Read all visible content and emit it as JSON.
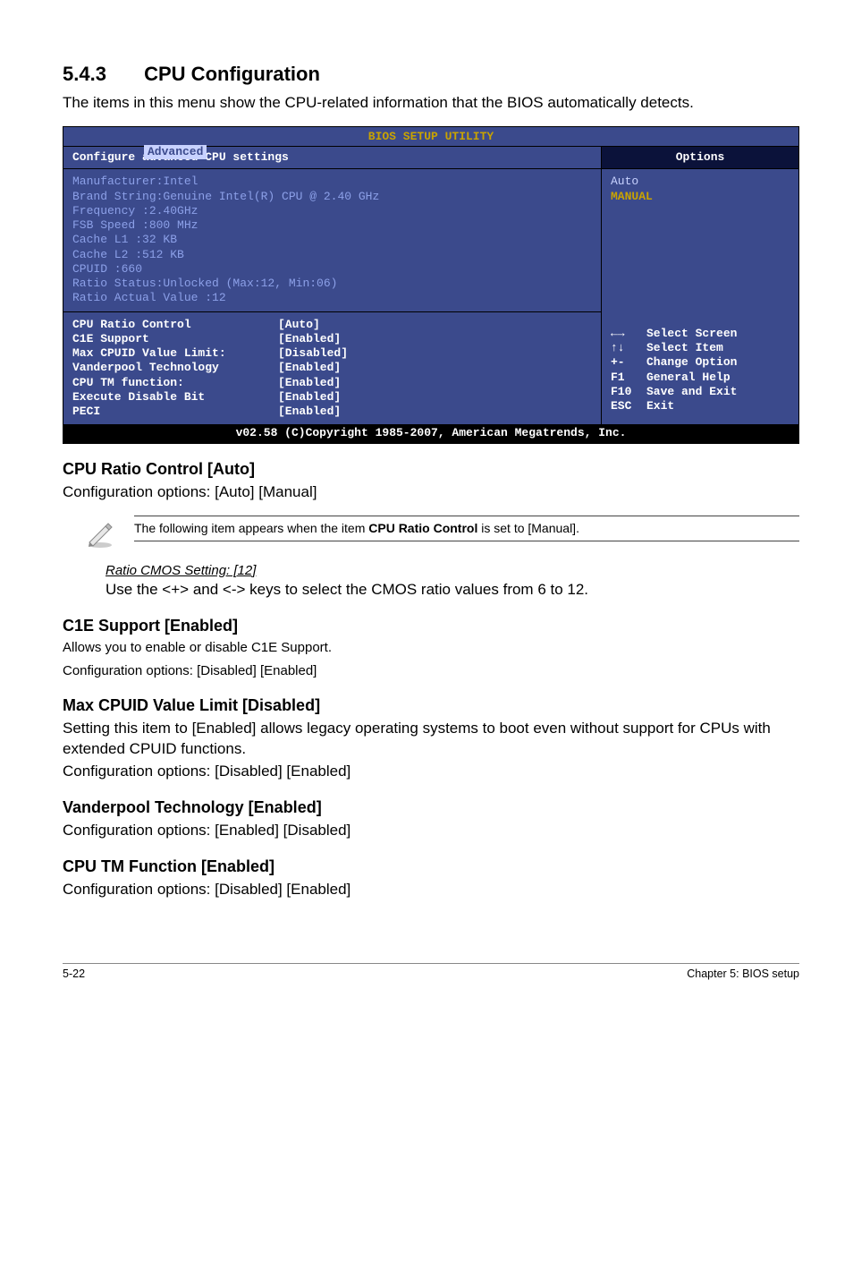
{
  "section": {
    "number": "5.4.3",
    "title": "CPU Configuration"
  },
  "intro": "The items in this menu show the CPU-related information that the BIOS automatically detects.",
  "bios": {
    "topTitle": "BIOS SETUP UTILITY",
    "tab": "Advanced",
    "leftHeader": "Configure advanced CPU settings",
    "info": {
      "l1": "Manufacturer:Intel",
      "l2": "Brand String:Genuine Intel(R) CPU @ 2.40 GHz",
      "l3": "Frequency   :2.40GHz",
      "l4": "FSB Speed   :800 MHz",
      "l5": "Cache L1    :32 KB",
      "l6": "Cache L2    :512 KB",
      "l7": "CPUID       :660",
      "l8": "Ratio Status:Unlocked (Max:12, Min:06)",
      "l9": "Ratio Actual Value  :12"
    },
    "settings": [
      {
        "k": "CPU Ratio Control",
        "v": "[Auto]"
      },
      {
        "k": "C1E Support",
        "v": "[Enabled]"
      },
      {
        "k": "Max CPUID Value Limit:",
        "v": "[Disabled]"
      },
      {
        "k": "Vanderpool Technology",
        "v": "[Enabled]"
      },
      {
        "k": "CPU TM function:",
        "v": "[Enabled]"
      },
      {
        "k": "Execute Disable Bit",
        "v": "[Enabled]"
      },
      {
        "k": "PECI",
        "v": "[Enabled]"
      }
    ],
    "rightHeader": "Options",
    "rightTop": {
      "auto": "Auto",
      "manual": "MANUAL"
    },
    "legend": [
      {
        "sym": "←→",
        "txt": "Select Screen"
      },
      {
        "sym": "↑↓",
        "txt": "Select Item"
      },
      {
        "sym": "+-",
        "txt": "Change Option"
      },
      {
        "sym": "F1",
        "txt": "General Help"
      },
      {
        "sym": "F10",
        "txt": "Save and Exit"
      },
      {
        "sym": "ESC",
        "txt": "Exit"
      }
    ],
    "foot": "v02.58 (C)Copyright 1985-2007, American Megatrends, Inc."
  },
  "items": {
    "cpuRatio": {
      "h": "CPU Ratio Control [Auto]",
      "p": "Configuration options: [Auto] [Manual]",
      "noteText1": "The following item appears when the item ",
      "noteBold": "CPU Ratio Control",
      "noteText2": " is set to [Manual].",
      "subH": "Ratio CMOS Setting: [12]",
      "subP": "Use the <+> and <-> keys to select the CMOS ratio values from 6 to 12."
    },
    "c1e": {
      "h": "C1E Support [Enabled]",
      "p1": "Allows you to enable or disable C1E Support.",
      "p2": "Configuration options: [Disabled] [Enabled]"
    },
    "maxCpuid": {
      "h": "Max CPUID Value Limit [Disabled]",
      "p1": "Setting this item to [Enabled] allows legacy operating systems to boot even without support for CPUs with extended CPUID functions.",
      "p2": "Configuration options: [Disabled] [Enabled]"
    },
    "vanderpool": {
      "h": "Vanderpool Technology [Enabled]",
      "p": "Configuration options: [Enabled] [Disabled]"
    },
    "cputm": {
      "h": "CPU TM Function [Enabled]",
      "p": "Configuration options: [Disabled] [Enabled]"
    }
  },
  "footer": {
    "left": "5-22",
    "right": "Chapter 5: BIOS setup"
  }
}
